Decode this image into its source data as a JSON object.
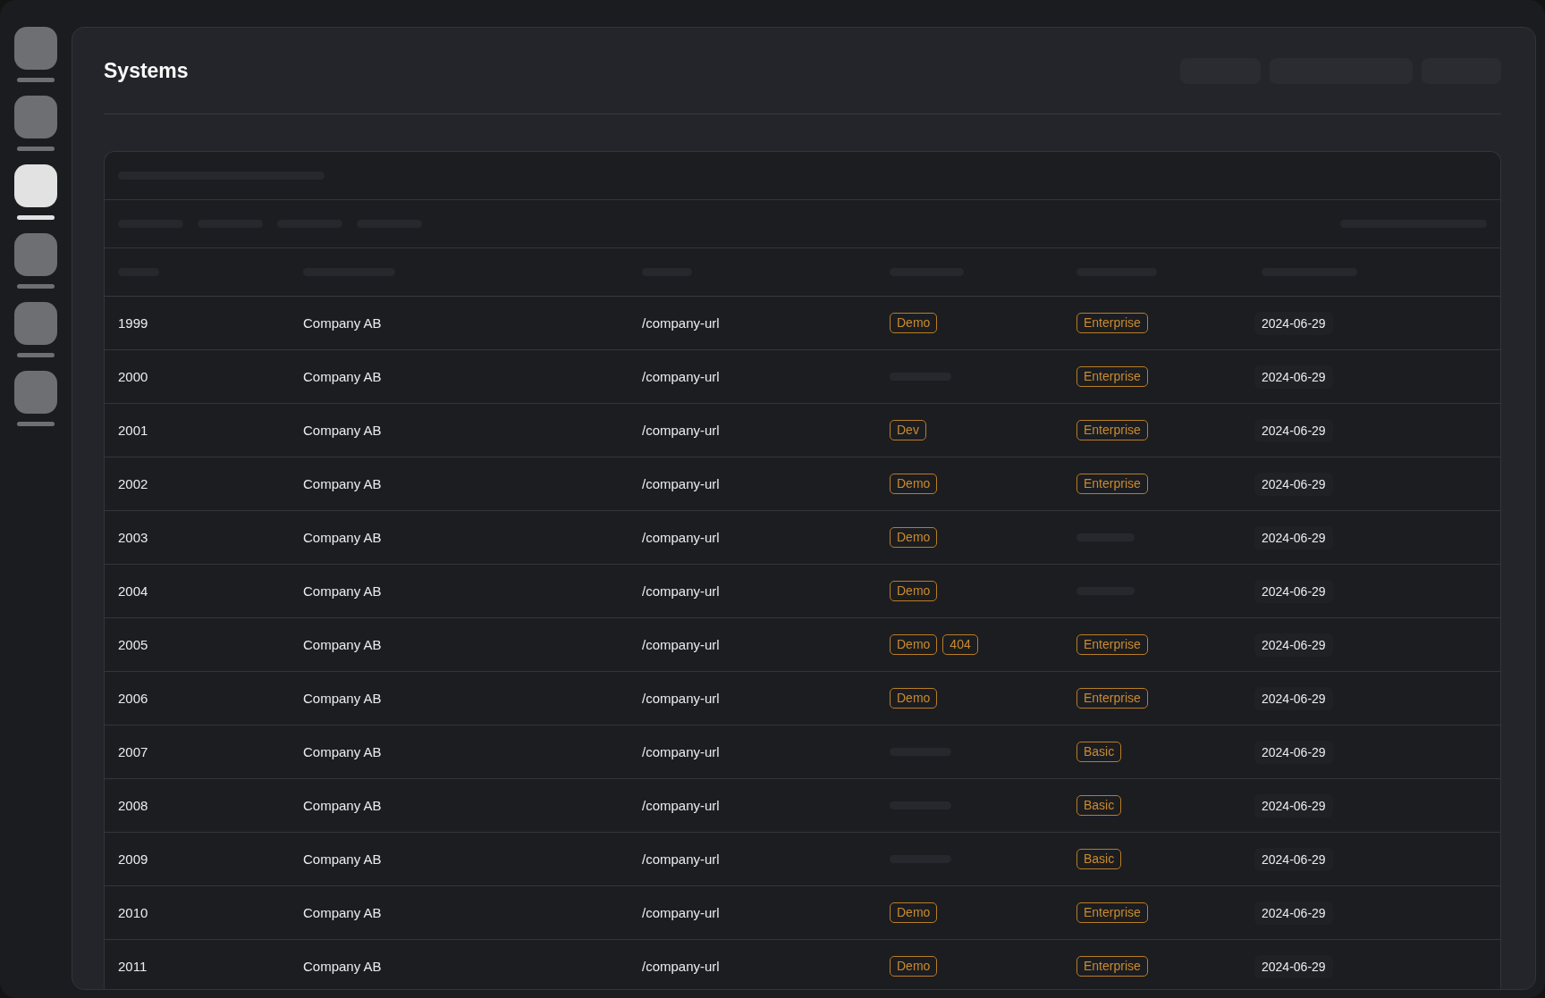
{
  "sidebar": {
    "items": [
      {
        "selected": false
      },
      {
        "selected": false
      },
      {
        "selected": true
      },
      {
        "selected": false
      },
      {
        "selected": false
      },
      {
        "selected": false
      }
    ]
  },
  "page": {
    "title": "Systems"
  },
  "table": {
    "rows": [
      {
        "id": "1999",
        "company": "Company AB",
        "url": "/company-url",
        "env": [
          "Demo"
        ],
        "plan": "Enterprise",
        "date": "2024-06-29"
      },
      {
        "id": "2000",
        "company": "Company AB",
        "url": "/company-url",
        "plan": "Enterprise",
        "date": "2024-06-29"
      },
      {
        "id": "2001",
        "company": "Company AB",
        "url": "/company-url",
        "env": [
          "Dev"
        ],
        "plan": "Enterprise",
        "date": "2024-06-29"
      },
      {
        "id": "2002",
        "company": "Company AB",
        "url": "/company-url",
        "env": [
          "Demo"
        ],
        "plan": "Enterprise",
        "date": "2024-06-29"
      },
      {
        "id": "2003",
        "company": "Company AB",
        "url": "/company-url",
        "env": [
          "Demo"
        ],
        "date": "2024-06-29"
      },
      {
        "id": "2004",
        "company": "Company AB",
        "url": "/company-url",
        "env": [
          "Demo"
        ],
        "date": "2024-06-29"
      },
      {
        "id": "2005",
        "company": "Company AB",
        "url": "/company-url",
        "env": [
          "Demo",
          "404"
        ],
        "plan": "Enterprise",
        "date": "2024-06-29"
      },
      {
        "id": "2006",
        "company": "Company AB",
        "url": "/company-url",
        "env": [
          "Demo"
        ],
        "plan": "Enterprise",
        "date": "2024-06-29"
      },
      {
        "id": "2007",
        "company": "Company AB",
        "url": "/company-url",
        "plan": "Basic",
        "date": "2024-06-29"
      },
      {
        "id": "2008",
        "company": "Company AB",
        "url": "/company-url",
        "plan": "Basic",
        "date": "2024-06-29"
      },
      {
        "id": "2009",
        "company": "Company AB",
        "url": "/company-url",
        "plan": "Basic",
        "date": "2024-06-29"
      },
      {
        "id": "2010",
        "company": "Company AB",
        "url": "/company-url",
        "env": [
          "Demo"
        ],
        "plan": "Enterprise",
        "date": "2024-06-29"
      },
      {
        "id": "2011",
        "company": "Company AB",
        "url": "/company-url",
        "env": [
          "Demo"
        ],
        "plan": "Enterprise",
        "date": "2024-06-29"
      }
    ]
  }
}
